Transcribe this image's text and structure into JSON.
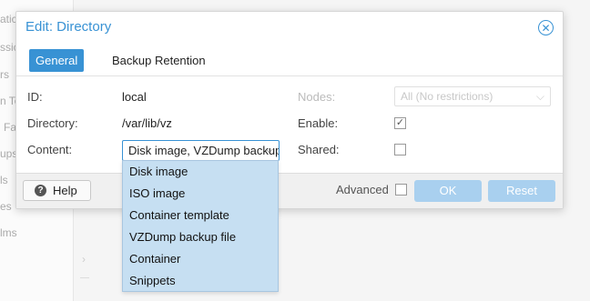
{
  "background": {
    "items": [
      "atic",
      "ssic",
      "rs",
      "n To",
      "Fa",
      "ups",
      "ls",
      "es",
      "lms"
    ]
  },
  "dialog": {
    "title": "Edit: Directory",
    "tabs": [
      {
        "label": "General",
        "active": true
      },
      {
        "label": "Backup Retention",
        "active": false
      }
    ],
    "fields": {
      "id_label": "ID:",
      "id_value": "local",
      "directory_label": "Directory:",
      "directory_value": "/var/lib/vz",
      "content_label": "Content:",
      "content_value": "Disk image, VZDump backup file",
      "nodes_label": "Nodes:",
      "nodes_placeholder": "All (No restrictions)",
      "enable_label": "Enable:",
      "enable_checked": true,
      "shared_label": "Shared:",
      "shared_checked": false
    },
    "footer": {
      "help_label": "Help",
      "advanced_label": "Advanced",
      "advanced_checked": false,
      "ok_label": "OK",
      "reset_label": "Reset"
    }
  },
  "content_dropdown": {
    "options": [
      "Disk image",
      "ISO image",
      "Container template",
      "VZDump backup file",
      "Container",
      "Snippets"
    ]
  },
  "colors": {
    "accent": "#3892d4",
    "dropdown_bg": "#c6dff2",
    "disabled_button": "#a9d0ef"
  }
}
